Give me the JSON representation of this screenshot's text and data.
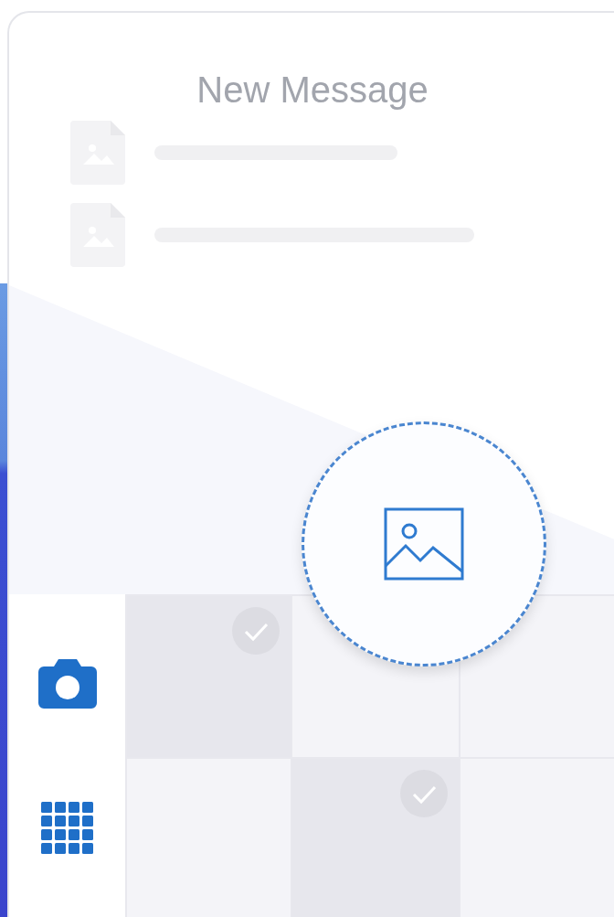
{
  "title": "New Message",
  "attachments": [
    {
      "kind": "image"
    },
    {
      "kind": "image"
    }
  ],
  "tools": [
    {
      "kind": "camera"
    },
    {
      "kind": "grid"
    }
  ],
  "tiles": [
    {
      "selected": true
    },
    {
      "selected": false
    },
    {
      "selected": false
    },
    {
      "selected": false
    },
    {
      "selected": true
    },
    {
      "selected": false
    }
  ]
}
